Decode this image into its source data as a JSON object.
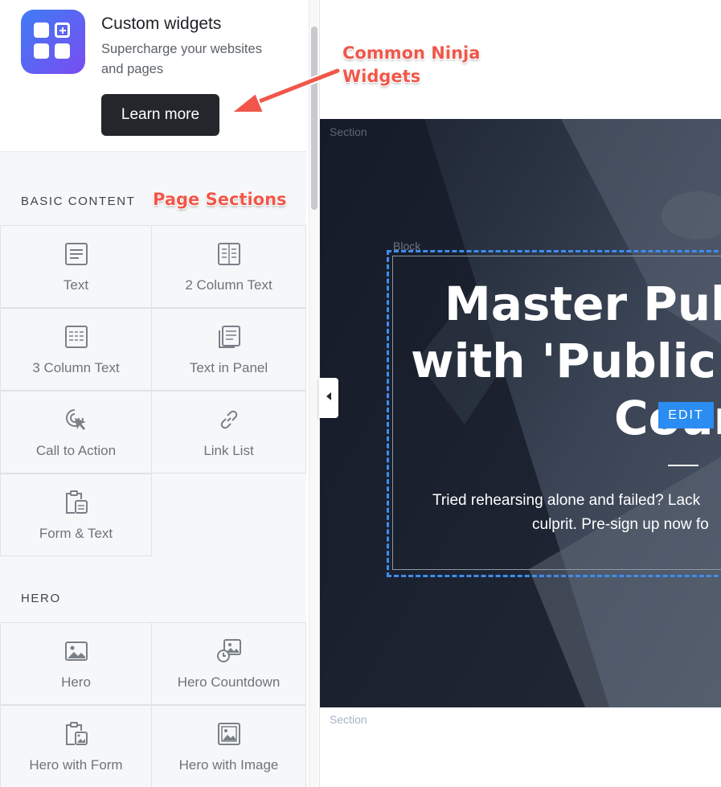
{
  "widget_promo": {
    "title": "Custom widgets",
    "subtitle": "Supercharge your websites and pages",
    "button_label": "Learn more",
    "icon": "widget-grid-plus-icon",
    "accent_gradient": [
      "#3f7cf6",
      "#7a4cf0"
    ]
  },
  "annotations": {
    "widgets_note": "Common Ninja Widgets",
    "sections_note": "Page Sections",
    "color": "#f0574a"
  },
  "sidebar": {
    "basic_content": {
      "heading": "BASIC CONTENT",
      "items": [
        {
          "label": "Text",
          "icon": "text-icon"
        },
        {
          "label": "2 Column Text",
          "icon": "two-column-text-icon"
        },
        {
          "label": "3 Column Text",
          "icon": "three-column-text-icon"
        },
        {
          "label": "Text in Panel",
          "icon": "text-panel-icon"
        },
        {
          "label": "Call to Action",
          "icon": "cursor-click-icon"
        },
        {
          "label": "Link List",
          "icon": "link-icon"
        },
        {
          "label": "Form & Text",
          "icon": "clipboard-form-icon"
        }
      ]
    },
    "hero": {
      "heading": "HERO",
      "items": [
        {
          "label": "Hero",
          "icon": "image-icon"
        },
        {
          "label": "Hero Countdown",
          "icon": "image-clock-icon"
        },
        {
          "label": "Hero with Form",
          "icon": "clipboard-image-icon"
        },
        {
          "label": "Hero with Image",
          "icon": "framed-image-icon"
        }
      ]
    }
  },
  "canvas": {
    "section_label": "Section",
    "block_label": "Block",
    "hero_title_lines": [
      "Master Public",
      "with 'Public Spe",
      "Cours"
    ],
    "edit_label": "EDIT",
    "hero_subtitle_lines": [
      "Tried rehearsing alone and failed? Lack",
      "culprit. Pre-sign up now fo"
    ],
    "lower_section_label": "Section",
    "edit_color": "#2b8cf2"
  }
}
